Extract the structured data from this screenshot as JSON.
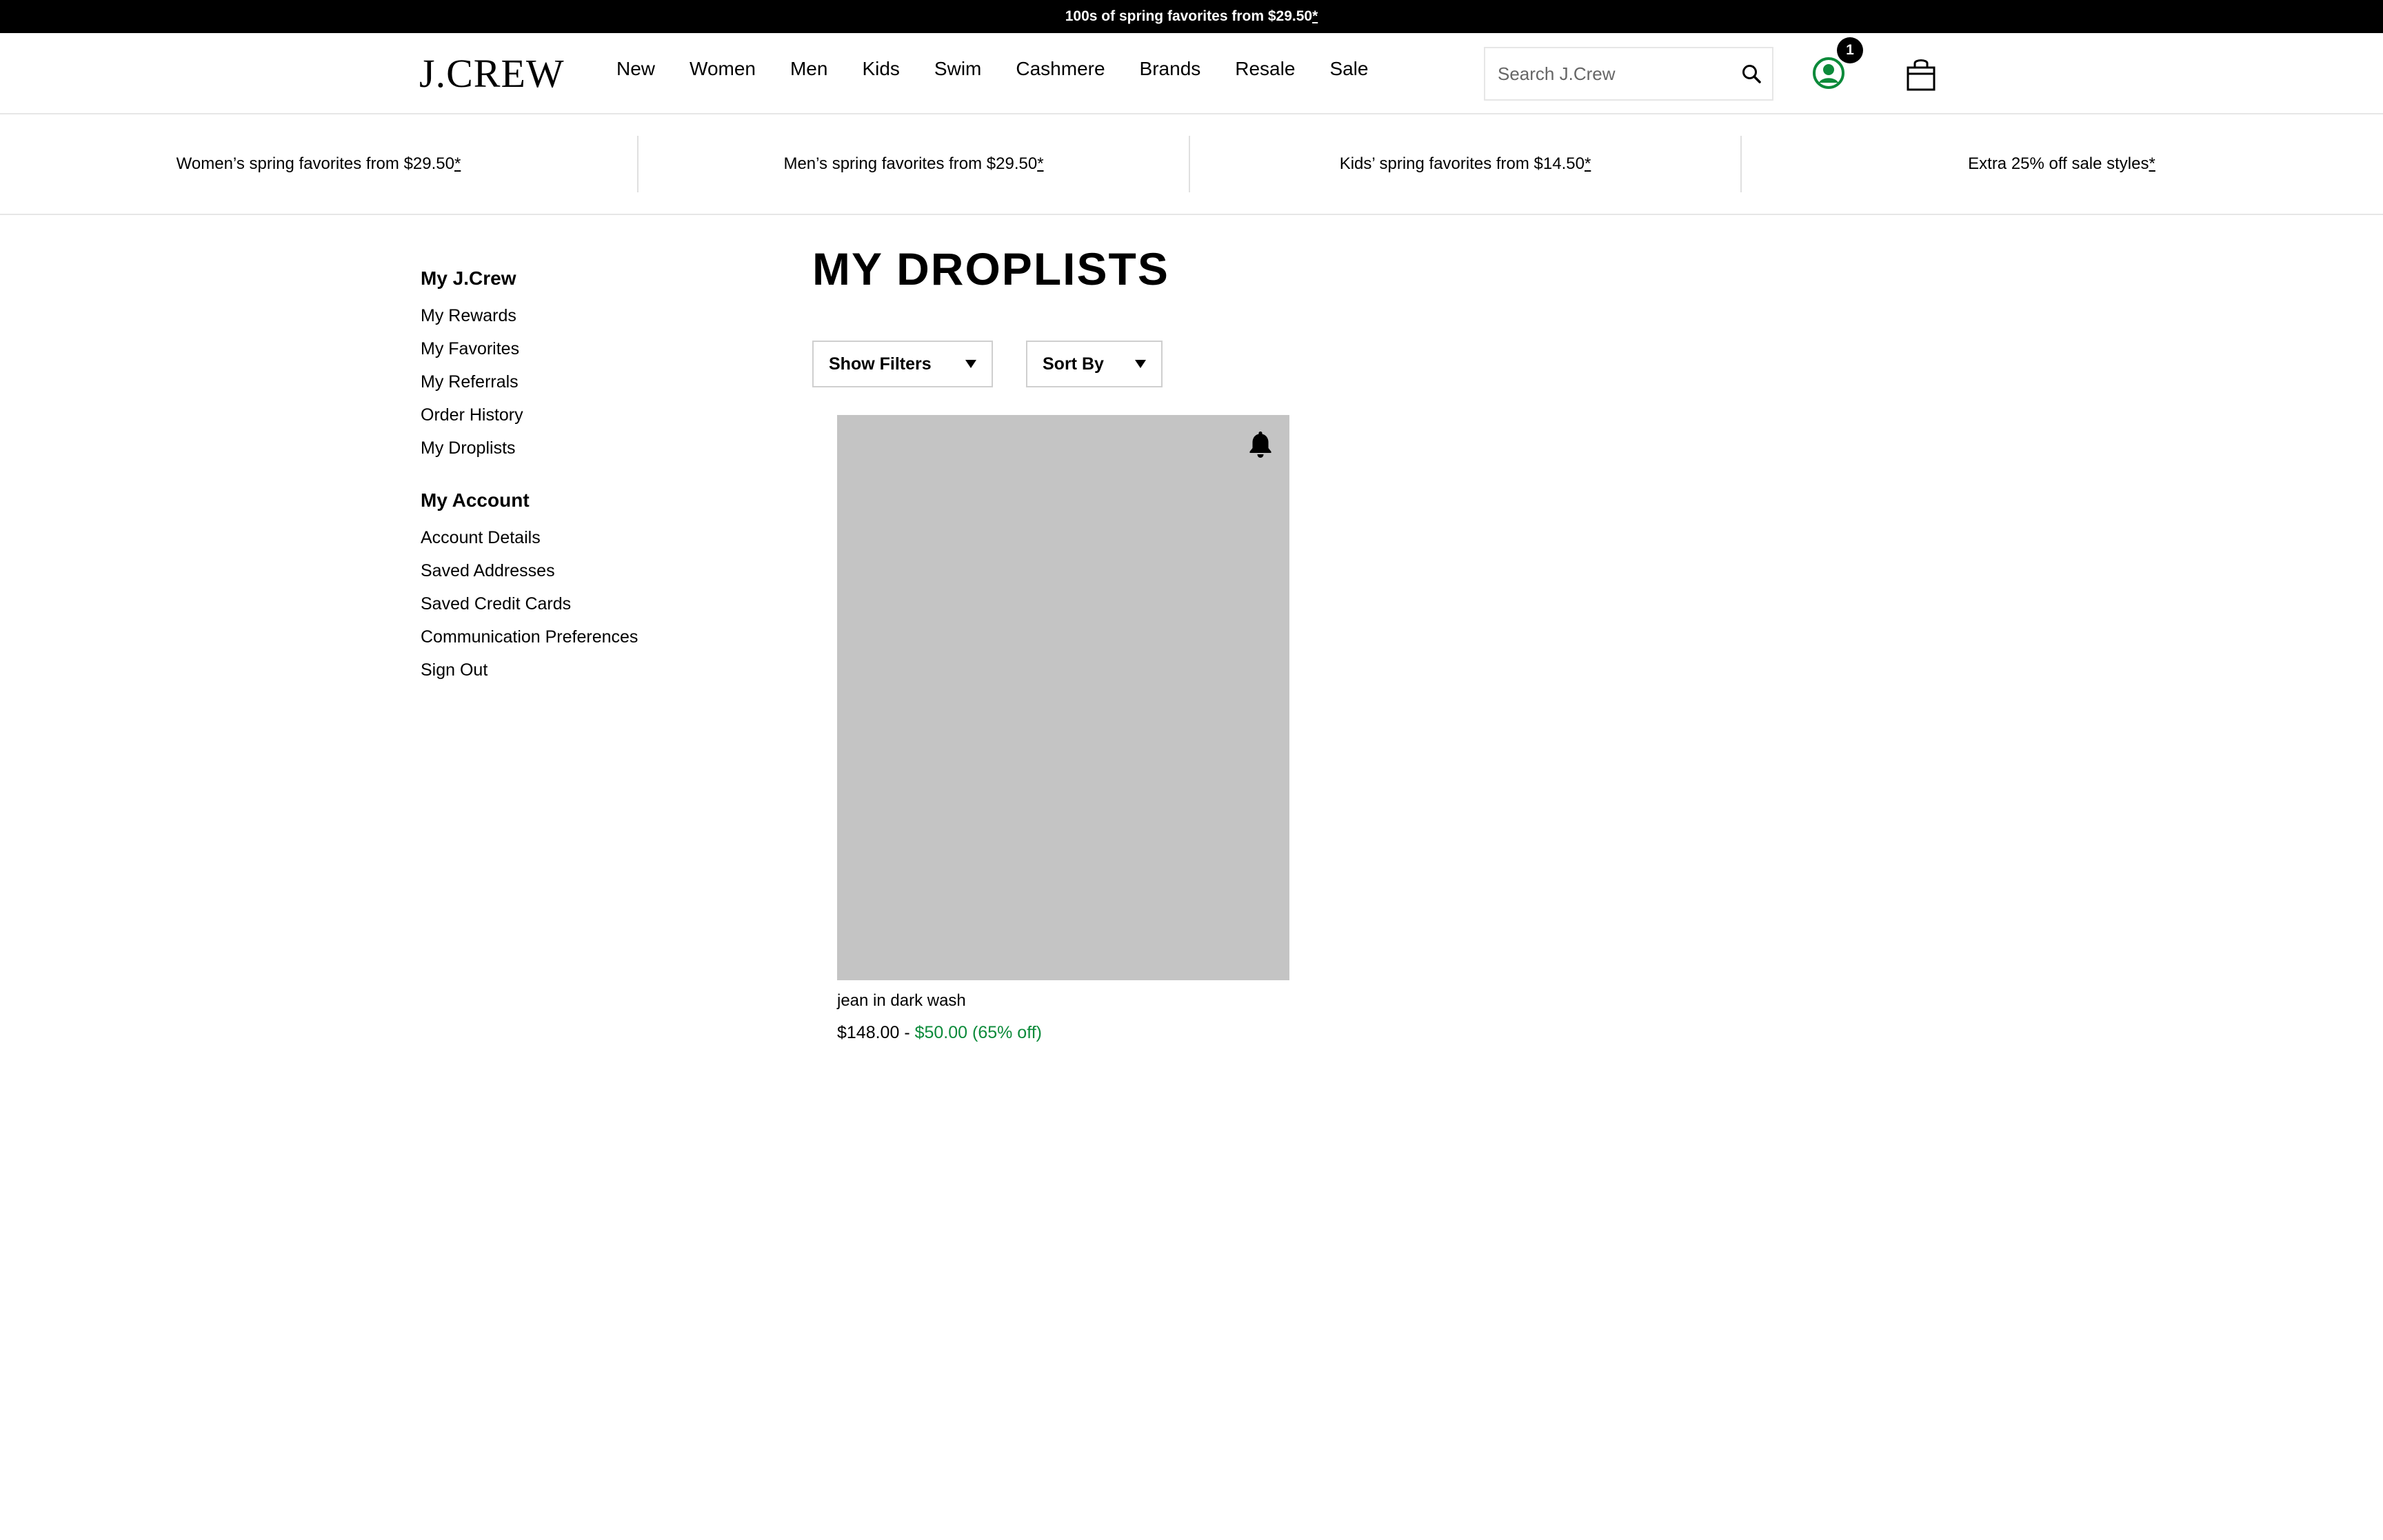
{
  "promo_bar": {
    "text": "100s of spring favorites from $29.50",
    "asterisk": "*"
  },
  "header": {
    "logo": "J.CREW",
    "nav": [
      "New",
      "Women",
      "Men",
      "Kids",
      "Swim",
      "Cashmere",
      "Brands",
      "Resale",
      "Sale"
    ],
    "search_placeholder": "Search J.Crew",
    "account_badge_count": "1",
    "account_icon": "account-icon",
    "bag_icon": "shopping-bag-icon",
    "accent_color": "#0c8a3a"
  },
  "subpromo": [
    {
      "text": "Women’s spring favorites from $29.50",
      "asterisk": "*"
    },
    {
      "text": "Men’s spring favorites from $29.50",
      "asterisk": "*"
    },
    {
      "text": "Kids’ spring favorites from $14.50",
      "asterisk": "*"
    },
    {
      "text": "Extra 25% off sale styles",
      "asterisk": "*"
    }
  ],
  "sidebar": {
    "group1": {
      "heading": "My J.Crew",
      "links": [
        "My Rewards",
        "My Favorites",
        "My Referrals",
        "Order History",
        "My Droplists"
      ]
    },
    "group2": {
      "heading": "My Account",
      "links": [
        "Account Details",
        "Saved Addresses",
        "Saved Credit Cards",
        "Communication Preferences",
        "Sign Out"
      ]
    }
  },
  "main": {
    "title": "MY DROPLISTS",
    "filters_label": "Show Filters",
    "sort_label": "Sort By",
    "products": [
      {
        "name": "jean in dark wash",
        "original_price": "$148.00",
        "separator": " - ",
        "sale_price": "$50.00 (65% off)",
        "image_color": "#c4c4c4"
      }
    ]
  }
}
